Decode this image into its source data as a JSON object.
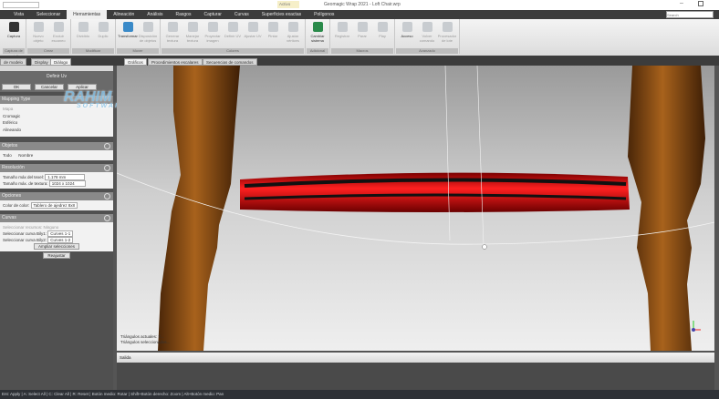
{
  "window": {
    "title": "Geomagic Wrap 2021 - Loft Chair.wrp",
    "active_badge": "Activo",
    "search_placeholder": "Search"
  },
  "menu": [
    "Vista",
    "Seleccionar",
    "Herramientas",
    "Alineación",
    "Análisis",
    "Rasgos",
    "Capturar",
    "Curvas",
    "Superficies exactas",
    "Polígonos"
  ],
  "ribbon": {
    "groups": [
      {
        "label": "Captura de pantalla",
        "buttons": [
          "Captura"
        ]
      },
      {
        "label": "Crear",
        "buttons": [
          "Nuevo objeto",
          "Excluir escaneo"
        ]
      },
      {
        "label": "Modificar",
        "buttons": [
          "Dividido",
          "Duplic"
        ]
      },
      {
        "label": "Mover",
        "buttons": [
          "Transformar",
          "Disposición de objetos"
        ]
      },
      {
        "label": "Colores",
        "buttons": [
          "Generar textura",
          "Manejar textura",
          "Proyectar imagen",
          "Definir UV",
          "Ajustar UV",
          "Pintar",
          "Ajustar vértices"
        ]
      },
      {
        "label": "Adicional",
        "buttons": [
          "Cambiar sistema"
        ]
      },
      {
        "label": "Macros",
        "buttons": [
          "Registrar",
          "Parar",
          "Play"
        ]
      },
      {
        "label": "Avanzado",
        "buttons": [
          "Acceso",
          "Volver comando",
          "Procesador de lote"
        ]
      }
    ]
  },
  "panel_tabs": [
    "de modelo",
    "Display",
    "Diálogo"
  ],
  "view_tabs": [
    "Gráficos",
    "Procedimientos escalares",
    "Secuencias de comandos"
  ],
  "dialog": {
    "title": "Definir Uv",
    "ok": "OK",
    "cancel": "Cancelar",
    "apply": "Aplicar",
    "mapping": {
      "header": "Mapping Type",
      "options": [
        "Mapa",
        "Cromagic",
        "Esférico",
        "Alineando"
      ]
    },
    "sec2": {
      "header": "Objetos",
      "todo": "Todo",
      "nombre": "Nombre"
    },
    "resolution": {
      "header": "Resolución",
      "texel_label": "Tamaño máx del texel:",
      "texel_value": "1.178 mm",
      "texture_label": "Tamaño máx. de textura:",
      "texture_value": "1024 x 1024"
    },
    "options": {
      "header": "Opciones",
      "color_label": "Color de color:",
      "color_value": "Tablero de ajedrez 8x8"
    },
    "curves": {
      "header": "Curvas",
      "res_label": "Seleccionar recursos:",
      "res_value": "Ninguno",
      "c1_label": "Seleccionar curva Bily1:",
      "c1_value": "Curves 1-1",
      "c2_label": "Seleccionar curva Bily2:",
      "c2_value": "Curves 1-2",
      "expand": "Ampliar selecciones",
      "reset": "Reajustar"
    }
  },
  "viewport": {
    "info1": "Triángulos actuales: 7...",
    "info2": "Triángulos seleccionados..."
  },
  "output": {
    "title": "Salida"
  },
  "status": "Ent: Apply | A: Select All | C: Clear All | R: Reset | Botón medio: Rotar | Shift+Botón derecho: Zoom | Alt+Botón medio: Pan",
  "watermark": {
    "line1": "RAHIM",
    "line2": "SOFTWARES"
  }
}
